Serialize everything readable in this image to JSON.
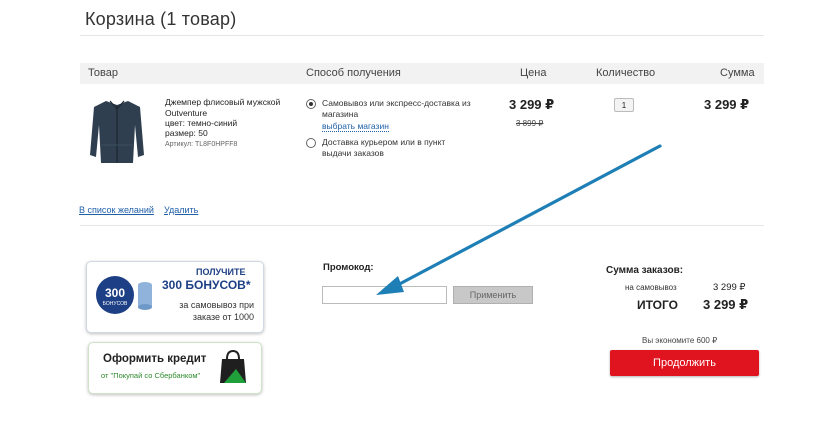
{
  "header": {
    "title": "Корзина (1 товар)"
  },
  "table": {
    "columns": {
      "product": "Товар",
      "method": "Способ получения",
      "price": "Цена",
      "qty": "Количество",
      "sum": "Сумма"
    }
  },
  "item": {
    "name": "Джемпер флисовый мужской Outventure",
    "color": "цвет: темно-синий",
    "size": "размер: 50",
    "article": "Артикул: TL8F0HPFF8",
    "price": "3 299 ₽",
    "old_price": "3 899 ₽",
    "quantity": "1",
    "sum": "3 299 ₽",
    "image_icon": "fleece-jacket-icon"
  },
  "delivery": {
    "option1": "Самовывоз или экспресс-доставка из магазина",
    "choose_store": "выбрать магазин",
    "option2": "Доставка курьером или в пункт выдачи заказов",
    "selected": 1
  },
  "links": {
    "wishlist": "В список желаний",
    "delete": "Удалить"
  },
  "bonus": {
    "badge_number": "300",
    "badge_label": "БОНУСОВ",
    "get": "ПОЛУЧИТЕ",
    "amount": "300 БОНУСОВ*",
    "description": "за самовывоз при заказе от 1000"
  },
  "credit": {
    "title": "Оформить кредит",
    "subtitle": "от \"Покупай со Сбербанком\""
  },
  "promo": {
    "label": "Промокод:",
    "value": "",
    "button": "Применить"
  },
  "summary": {
    "title": "Сумма заказов:",
    "pickup_label": "на самовывоз",
    "pickup_value": "3 299 ₽",
    "total_label": "ИТОГО",
    "total_value": "3 299 ₽",
    "savings": "Вы экономите 600 ₽",
    "continue": "Продолжить"
  },
  "colors": {
    "accent_red": "#e0141e",
    "link_blue": "#1f5fa8",
    "arrow": "#1e7fb6"
  }
}
